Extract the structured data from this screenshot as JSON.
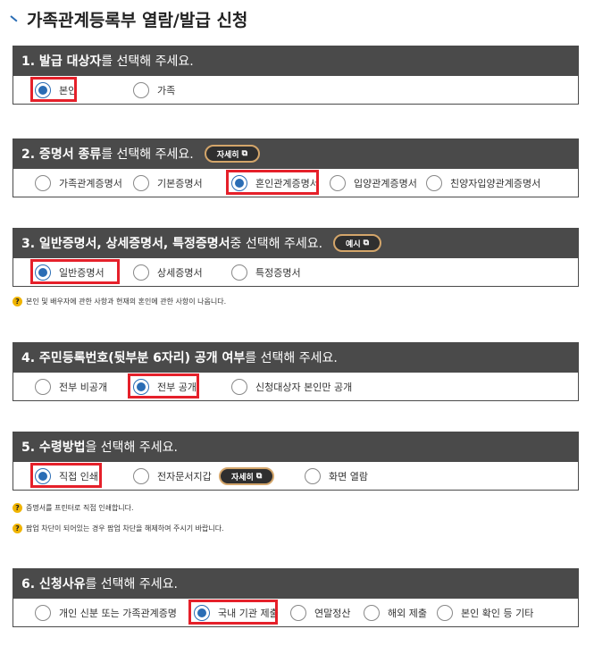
{
  "page_title": "가족관계등록부 열람/발급 신청",
  "sections": {
    "s1": {
      "strong": "1. 발급 대상자",
      "rest": "를 선택해 주세요.",
      "options": [
        "본인",
        "가족"
      ]
    },
    "s2": {
      "strong": "2. 증명서 종류",
      "rest": "를 선택해 주세요.",
      "detail_button": "자세히",
      "options": [
        "가족관계증명서",
        "기본증명서",
        "혼인관계증명서",
        "입양관계증명서",
        "친양자입양관계증명서"
      ]
    },
    "s3": {
      "strong": "3. 일반증명서, 상세증명서, 특정증명서",
      "rest": " 중 선택해 주세요.",
      "example_button": "예시",
      "options": [
        "일반증명서",
        "상세증명서",
        "특정증명서"
      ],
      "note": "본인 및 배우자에 관한 사항과 현재의 혼인에 관한 사항이 나옵니다."
    },
    "s4": {
      "strong": "4. 주민등록번호(뒷부분 6자리) 공개 여부",
      "rest": "를 선택해 주세요.",
      "options": [
        "전부 비공개",
        "전부 공개",
        "신청대상자 본인만 공개"
      ]
    },
    "s5": {
      "strong": "5. 수령방법",
      "rest": "을 선택해 주세요.",
      "options": [
        "직접 인쇄",
        "전자문서지갑",
        "화면 열람"
      ],
      "detail_button": "자세히",
      "notes": [
        "증명서를 프린터로 직접 인쇄합니다.",
        "팝업 차단이 되어있는 경우 팝업 차단을 해제하여 주시기 바랍니다."
      ]
    },
    "s6": {
      "strong": "6. 신청사유",
      "rest": "를 선택해 주세요.",
      "options": [
        "개인 신분 또는 가족관계증명",
        "국내 기관 제출",
        "연말정산",
        "해외 제출",
        "본인 확인 등 기타"
      ]
    }
  },
  "selected": {
    "s1": "본인",
    "s2": "혼인관계증명서",
    "s3": "일반증명서",
    "s4": "전부 공개",
    "s5": "직접 인쇄",
    "s6": "국내 기관 제출"
  },
  "ext_icon": "external-link-icon",
  "help_icon": "question-icon",
  "colors": {
    "header_bg": "#4a4a4a",
    "radio_selected": "#2a6db5",
    "highlight": "#e5202a",
    "pill_border": "#d3a56a",
    "note_icon": "#f0b400"
  }
}
